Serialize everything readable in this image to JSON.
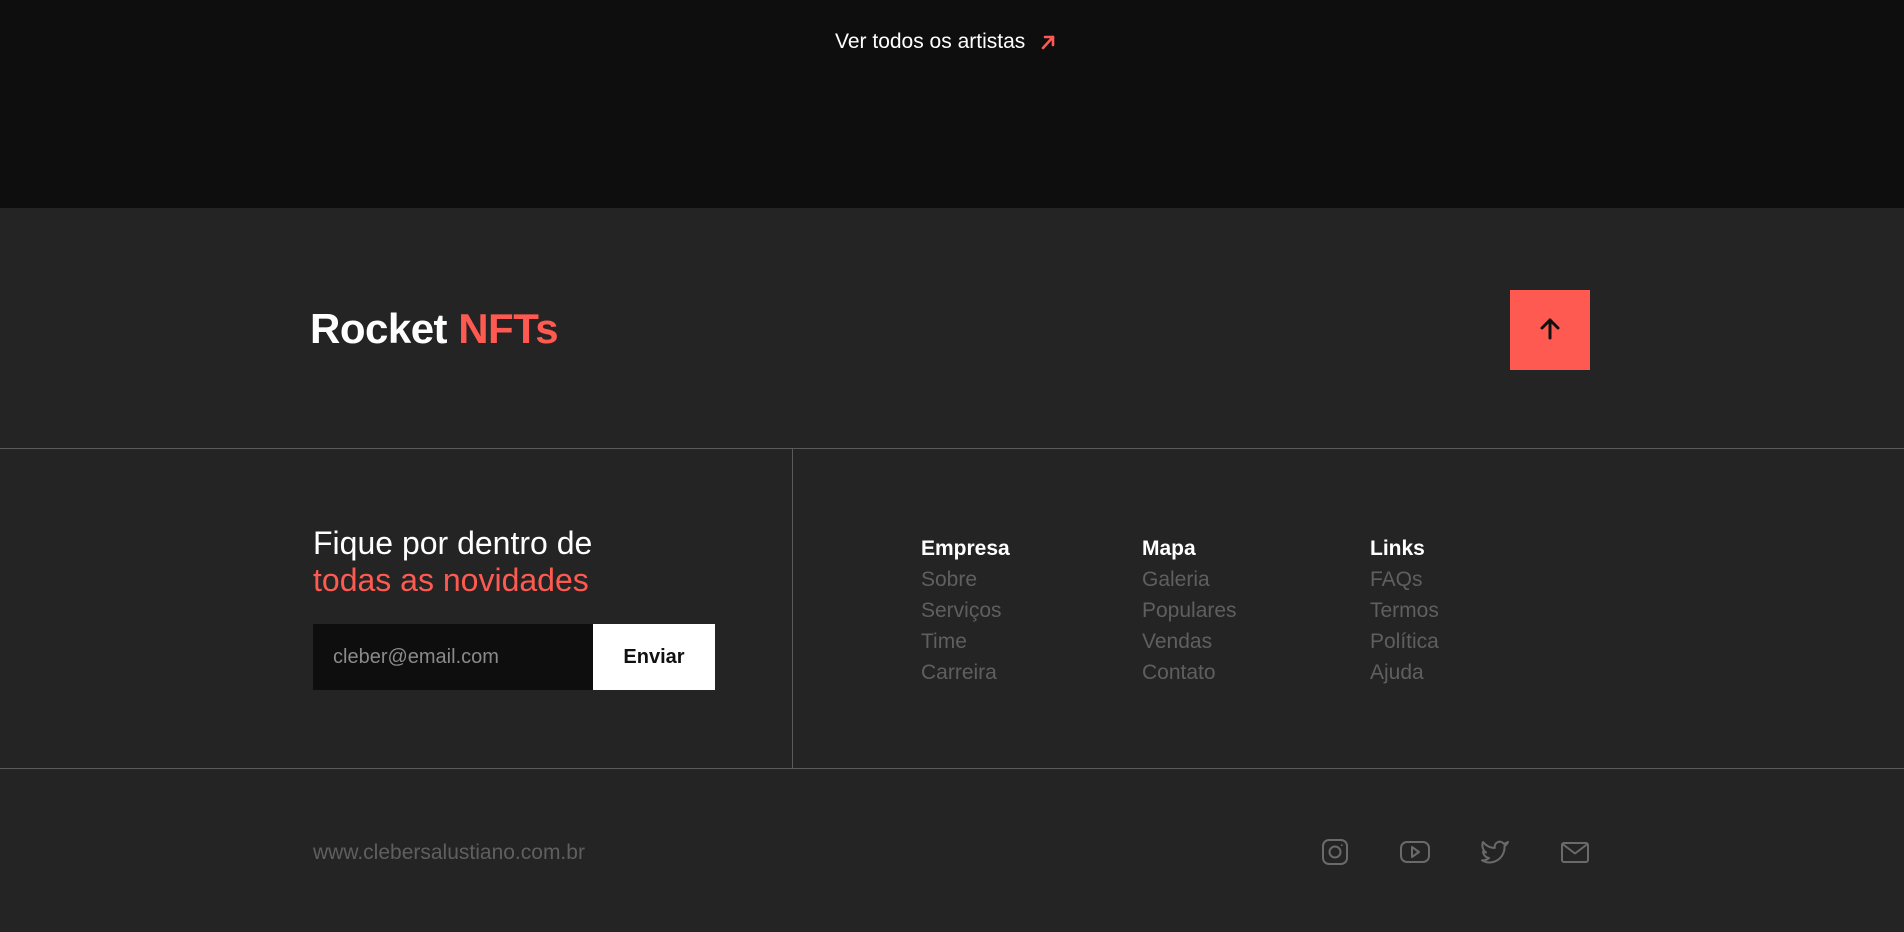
{
  "see_all": {
    "label": "Ver todos os artistas",
    "icon": "arrow-up-right-icon"
  },
  "brand": {
    "part1": "Rocket ",
    "part2": "NFTs"
  },
  "back_to_top": {
    "icon": "arrow-up-icon"
  },
  "newsletter": {
    "title_line1": "Fique por dentro de",
    "title_line2": "todas as novidades",
    "email_placeholder": "cleber@email.com",
    "email_value": "",
    "send_label": "Enviar"
  },
  "columns": [
    {
      "title": "Empresa",
      "links": [
        "Sobre",
        "Serviços",
        "Time",
        "Carreira"
      ]
    },
    {
      "title": "Mapa",
      "links": [
        "Galeria",
        "Populares",
        "Vendas",
        "Contato"
      ]
    },
    {
      "title": "Links",
      "links": [
        "FAQs",
        "Termos",
        "Política",
        "Ajuda"
      ]
    }
  ],
  "footer": {
    "site_url": "www.clebersalustiano.com.br",
    "social": [
      "instagram-icon",
      "youtube-icon",
      "twitter-icon",
      "mail-icon"
    ]
  },
  "colors": {
    "accent": "#ff5a51",
    "background": "#242424",
    "dark": "#0e0e0e",
    "muted_text": "#5f5f5f"
  }
}
